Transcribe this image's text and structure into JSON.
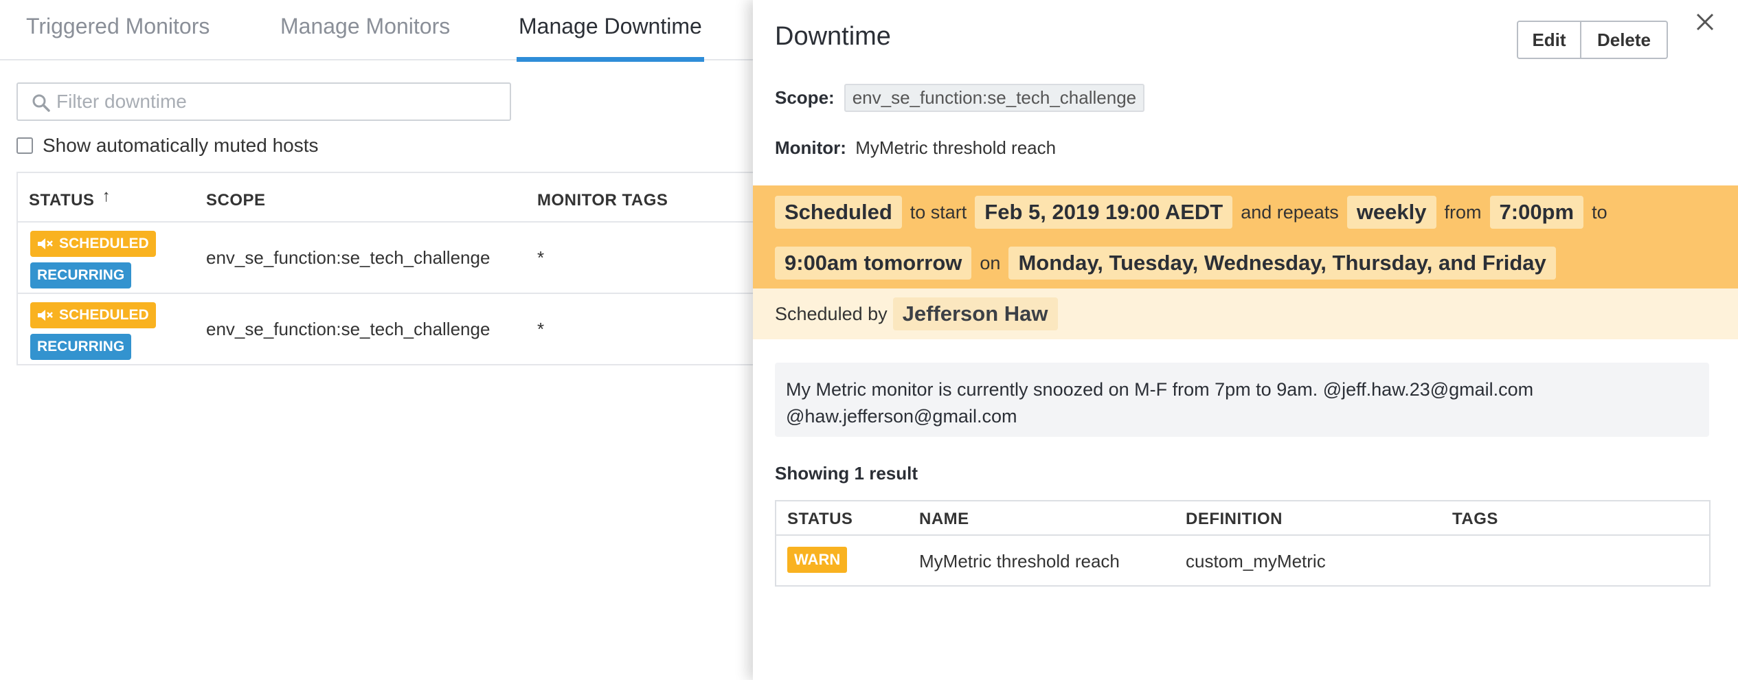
{
  "tabs": [
    {
      "label": "Triggered Monitors"
    },
    {
      "label": "Manage Monitors"
    },
    {
      "label": "Manage Downtime"
    }
  ],
  "filter": {
    "placeholder": "Filter downtime"
  },
  "automute": {
    "label": "Show automatically muted hosts"
  },
  "downtime_table": {
    "headers": {
      "status": "STATUS",
      "sort_arrow": "↑",
      "scope": "SCOPE",
      "monitor_tags": "MONITOR TAGS"
    },
    "rows": [
      {
        "status": "SCHEDULED",
        "recurrence": "RECURRING",
        "scope": "env_se_function:se_tech_challenge",
        "tags": "*"
      },
      {
        "status": "SCHEDULED",
        "recurrence": "RECURRING",
        "scope": "env_se_function:se_tech_challenge",
        "tags": "*"
      }
    ]
  },
  "panel": {
    "title": "Downtime",
    "edit_label": "Edit",
    "delete_label": "Delete",
    "scope_label": "Scope:",
    "scope_value": "env_se_function:se_tech_challenge",
    "monitor_label": "Monitor:",
    "monitor_value": "MyMetric threshold reach",
    "schedule": {
      "status": "Scheduled",
      "to_start": "to start",
      "start": "Feb 5, 2019 19:00 AEDT",
      "and_repeats": "and repeats",
      "frequency": "weekly",
      "from": "from",
      "from_time": "7:00pm",
      "to": "to",
      "to_time": "9:00am tomorrow",
      "on": "on",
      "days": "Monday, Tuesday, Wednesday, Thursday, and Friday"
    },
    "scheduled_by_label": "Scheduled by",
    "scheduled_by": "Jefferson Haw",
    "message_line1": "My Metric monitor is currently snoozed on M-F from 7pm to 9am. @jeff.haw.23@gmail.com",
    "message_line2": "@haw.jefferson@gmail.com",
    "showing": "Showing 1 result",
    "monitor_table": {
      "headers": {
        "status": "STATUS",
        "name": "NAME",
        "definition": "DEFINITION",
        "tags": "TAGS"
      },
      "rows": [
        {
          "status": "WARN",
          "name": "MyMetric threshold reach",
          "definition": "custom_myMetric",
          "tags": ""
        }
      ]
    }
  },
  "colors": {
    "accent": "#2f8dd8",
    "scheduled": "#f9b220",
    "recurring": "#3393cf",
    "schedule_banner": "#fcc56b",
    "scheduled_by_bg": "#fef2da"
  },
  "icons": {
    "search": "search-icon",
    "mute": "volume-mute-icon",
    "close": "close-icon"
  }
}
